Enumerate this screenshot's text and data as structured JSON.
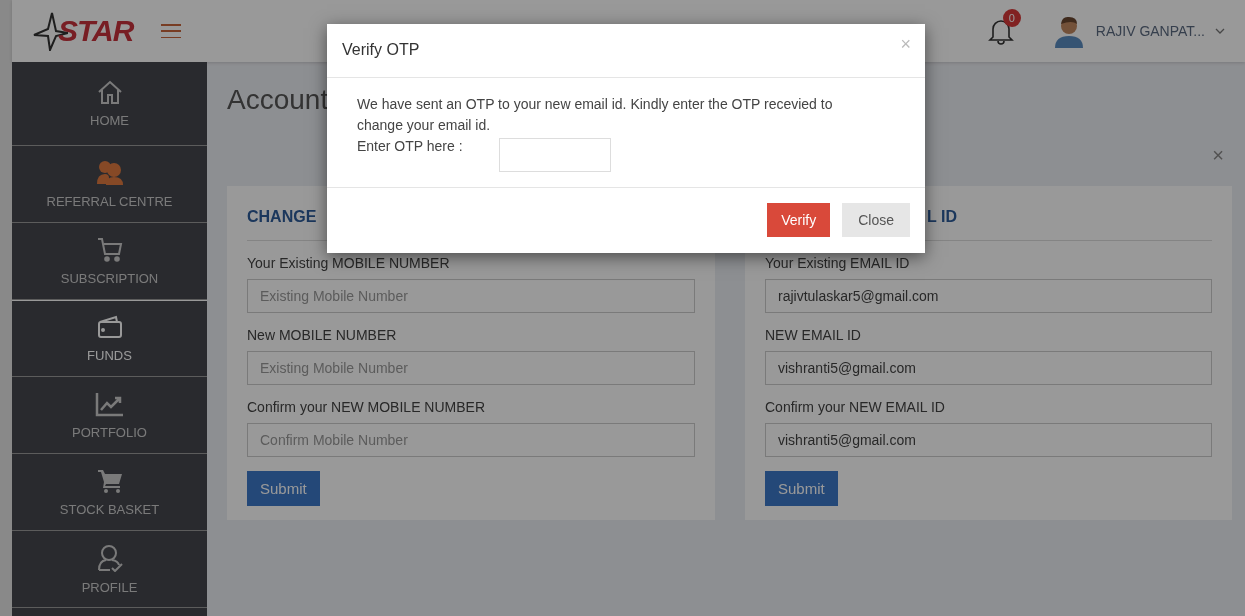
{
  "header": {
    "logo": "STAR",
    "notifications": "0",
    "user": "RAJIV GANPAT..."
  },
  "sidebar": {
    "items": [
      {
        "label": "HOME",
        "selected": false
      },
      {
        "label": "REFERRAL CENTRE",
        "selected": false
      },
      {
        "label": "SUBSCRIPTION",
        "selected": false
      },
      {
        "label": "FUNDS",
        "selected": true
      },
      {
        "label": "PORTFOLIO",
        "selected": false
      },
      {
        "label": "STOCK BASKET",
        "selected": false
      },
      {
        "label": "PROFILE",
        "selected": false
      }
    ]
  },
  "page": {
    "title": "Account",
    "alert_close": "×",
    "cards": [
      {
        "title": "CHANGE",
        "fields": [
          {
            "label": "Your Existing MOBILE NUMBER",
            "placeholder": "Existing Mobile Number"
          },
          {
            "label": "New MOBILE NUMBER",
            "placeholder": "Existing Mobile Number"
          },
          {
            "label": "Confirm your NEW MOBILE NUMBER",
            "placeholder": "Confirm Mobile Number"
          }
        ],
        "button": "Submit"
      },
      {
        "title": "L ID",
        "fields": [
          {
            "label": "Your Existing EMAIL ID",
            "value": "rajivtulaskar5@gmail.com"
          },
          {
            "label": "NEW EMAIL ID",
            "value": "vishranti5@gmail.com"
          },
          {
            "label": "Confirm your NEW EMAIL ID",
            "value": "vishranti5@gmail.com"
          }
        ],
        "button": "Submit"
      }
    ]
  },
  "modal": {
    "title": "Verify OTP",
    "close": "×",
    "message": "We have sent an OTP to your new email id. Kindly enter the OTP recevied to change your email id.",
    "otp_label": "Enter OTP here :",
    "buttons": [
      {
        "label": "Verify",
        "kind": "primary"
      },
      {
        "label": "Close",
        "kind": "default"
      }
    ]
  }
}
